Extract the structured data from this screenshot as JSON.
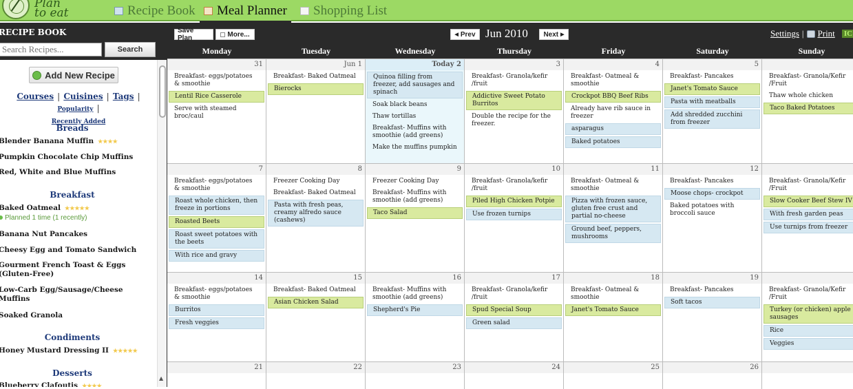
{
  "app": {
    "logo_text_line1": "Plan",
    "logo_text_line2": "to eat",
    "nav_tabs": [
      {
        "label": "Recipe Book",
        "icon": "book-icon",
        "active": false
      },
      {
        "label": "Meal Planner",
        "icon": "calendar-icon",
        "active": true
      },
      {
        "label": "Shopping List",
        "icon": "document-icon",
        "active": false
      }
    ]
  },
  "sidebar": {
    "title": "RECIPE BOOK",
    "search_placeholder": "Search Recipes...",
    "search_button": "Search",
    "add_button": "Add New Recipe",
    "filters": {
      "courses": "Courses",
      "cuisines": "Cuisines",
      "tags": "Tags",
      "popularity": "Popularity",
      "recently_added": "Recently Added",
      "separator": "|"
    },
    "categories": [
      {
        "name": "Breads",
        "recipes": [
          {
            "name": "Blender Banana Muffin",
            "rating": 4
          },
          {
            "name": "Pumpkin Chocolate Chip Muffins",
            "rating": 0
          },
          {
            "name": "Red, White and Blue Muffins",
            "rating": 0
          }
        ]
      },
      {
        "name": "Breakfast",
        "recipes": [
          {
            "name": "Baked Oatmeal",
            "rating": 5,
            "planned": "Planned 1 time (1 recently)"
          },
          {
            "name": "Banana Nut Pancakes",
            "rating": 0
          },
          {
            "name": "Cheesy Egg and Tomato Sandwich",
            "rating": 0
          },
          {
            "name": "Gourment French Toast & Eggs (Gluten-Free)",
            "rating": 0
          },
          {
            "name": "Low-Carb Egg/Sausage/Cheese Muffins",
            "rating": 0
          },
          {
            "name": "Soaked Granola",
            "rating": 0
          }
        ]
      },
      {
        "name": "Condiments",
        "recipes": [
          {
            "name": "Honey Mustard Dressing II",
            "rating": 5
          }
        ]
      },
      {
        "name": "Desserts",
        "recipes": [
          {
            "name": "Blueberry Clafoutis",
            "rating": 4
          }
        ]
      }
    ],
    "stars_4": "★★★★",
    "stars_5": "★★★★★",
    "scroll_up": "▲"
  },
  "toolbar": {
    "save_plan": "Save Plan",
    "more": "More...",
    "prev": "Prev",
    "next": "Next",
    "prev_arrow": "◀",
    "next_arrow": "▶",
    "month": "Jun 2010",
    "settings": "Settings",
    "separator": "|",
    "print": "Print",
    "ic_badge": "IC"
  },
  "calendar": {
    "weekdays": [
      "Monday",
      "Tuesday",
      "Wednesday",
      "Thursday",
      "Friday",
      "Saturday",
      "Sunday"
    ],
    "weeks": [
      [
        {
          "label": "31",
          "items": [
            {
              "text": "Breakfast- eggs/potatoes & smoothie",
              "type": "plain"
            },
            {
              "text": "Lentil Rice Casserole",
              "type": "recipe"
            },
            {
              "text": "Serve with steamed broc/caul",
              "type": "plain"
            }
          ]
        },
        {
          "label": "Jun 1",
          "items": [
            {
              "text": "Breakfast- Baked Oatmeal",
              "type": "plain"
            },
            {
              "text": "Bierocks",
              "type": "recipe"
            }
          ]
        },
        {
          "label": "Today 2",
          "today": true,
          "items": [
            {
              "text": "Quinoa filling from freezer, add sausages and spinach",
              "type": "note"
            },
            {
              "text": "Soak black beans",
              "type": "plain"
            },
            {
              "text": "Thaw tortillas",
              "type": "plain"
            },
            {
              "text": "Breakfast- Muffins with smoothie (add greens)",
              "type": "plain"
            },
            {
              "text": "Make the muffins pumpkin",
              "type": "plain"
            }
          ]
        },
        {
          "label": "3",
          "items": [
            {
              "text": "Breakfast- Granola/kefir /fruit",
              "type": "plain"
            },
            {
              "text": "Addictive Sweet Potato Burritos",
              "type": "recipe"
            },
            {
              "text": "Double the recipe for the freezer.",
              "type": "plain"
            }
          ]
        },
        {
          "label": "4",
          "items": [
            {
              "text": "Breakfast- Oatmeal & smoothie",
              "type": "plain"
            },
            {
              "text": "Crockpot BBQ Beef Ribs",
              "type": "recipe"
            },
            {
              "text": "Already have rib sauce in freezer",
              "type": "plain"
            },
            {
              "text": "asparagus",
              "type": "note"
            },
            {
              "text": "Baked potatoes",
              "type": "note"
            }
          ]
        },
        {
          "label": "5",
          "items": [
            {
              "text": "Breakfast- Pancakes",
              "type": "plain"
            },
            {
              "text": "Janet's Tomato Sauce",
              "type": "recipe"
            },
            {
              "text": "Pasta with meatballs",
              "type": "note"
            },
            {
              "text": "Add shredded zucchini from freezer",
              "type": "note"
            }
          ]
        },
        {
          "label": "",
          "items": [
            {
              "text": "Breakfast- Granola/Kefir /Fruit",
              "type": "plain"
            },
            {
              "text": "Thaw whole chicken",
              "type": "plain"
            },
            {
              "text": "Taco Baked Potatoes",
              "type": "recipe"
            }
          ]
        }
      ],
      [
        {
          "label": "7",
          "items": [
            {
              "text": "Breakfast- eggs/potatoes & smoothie",
              "type": "plain"
            },
            {
              "text": "Roast whole chicken, then freeze in portions",
              "type": "note"
            },
            {
              "text": "Roasted Beets",
              "type": "recipe"
            },
            {
              "text": "Roast sweet potatoes with the beets",
              "type": "note"
            },
            {
              "text": "With rice and gravy",
              "type": "note"
            }
          ]
        },
        {
          "label": "8",
          "items": [
            {
              "text": "Freezer Cooking Day",
              "type": "plain"
            },
            {
              "text": "Breakfast- Baked Oatmeal",
              "type": "plain"
            },
            {
              "text": "Pasta with fresh peas, creamy alfredo sauce (cashews)",
              "type": "note"
            }
          ]
        },
        {
          "label": "9",
          "items": [
            {
              "text": "Freezer Cooking Day",
              "type": "plain"
            },
            {
              "text": "Breakfast- Muffins with smoothie (add greens)",
              "type": "plain"
            },
            {
              "text": "Taco Salad",
              "type": "recipe"
            }
          ]
        },
        {
          "label": "10",
          "items": [
            {
              "text": "Breakfast- Granola/kefir /fruit",
              "type": "plain"
            },
            {
              "text": "Piled High Chicken Potpie",
              "type": "recipe"
            },
            {
              "text": "Use frozen turnips",
              "type": "note"
            }
          ]
        },
        {
          "label": "11",
          "items": [
            {
              "text": "Breakfast- Oatmeal & smoothie",
              "type": "plain"
            },
            {
              "text": "Pizza with frozen sauce, gluten free crust and partial no-cheese",
              "type": "note"
            },
            {
              "text": "Ground beef, peppers, mushrooms",
              "type": "note"
            }
          ]
        },
        {
          "label": "12",
          "items": [
            {
              "text": "Breakfast- Pancakes",
              "type": "plain"
            },
            {
              "text": "Moose chops- crockpot",
              "type": "note"
            },
            {
              "text": "Baked potatoes with broccoli sauce",
              "type": "plain"
            }
          ]
        },
        {
          "label": "",
          "items": [
            {
              "text": "Breakfast- Granola/Kefir /Fruit",
              "type": "plain"
            },
            {
              "text": "Slow Cooker Beef Stew IV",
              "type": "recipe"
            },
            {
              "text": "With fresh garden peas",
              "type": "note"
            },
            {
              "text": "Use turnips from freezer",
              "type": "note"
            }
          ]
        }
      ],
      [
        {
          "label": "14",
          "items": [
            {
              "text": "Breakfast- eggs/potatoes & smoothie",
              "type": "plain"
            },
            {
              "text": "Burritos",
              "type": "note"
            },
            {
              "text": "Fresh veggies",
              "type": "note"
            }
          ]
        },
        {
          "label": "15",
          "items": [
            {
              "text": "Breakfast- Baked Oatmeal",
              "type": "plain"
            },
            {
              "text": "Asian Chicken Salad",
              "type": "recipe"
            }
          ]
        },
        {
          "label": "16",
          "items": [
            {
              "text": "Breakfast- Muffins with smoothie (add greens)",
              "type": "plain"
            },
            {
              "text": "Shepherd's Pie",
              "type": "note"
            }
          ]
        },
        {
          "label": "17",
          "items": [
            {
              "text": "Breakfast- Granola/kefir /fruit",
              "type": "plain"
            },
            {
              "text": "Spud Special Soup",
              "type": "recipe"
            },
            {
              "text": "Green salad",
              "type": "note"
            }
          ]
        },
        {
          "label": "18",
          "items": [
            {
              "text": "Breakfast- Oatmeal & smoothie",
              "type": "plain"
            },
            {
              "text": "Janet's Tomato Sauce",
              "type": "recipe"
            }
          ]
        },
        {
          "label": "19",
          "items": [
            {
              "text": "Breakfast- Pancakes",
              "type": "plain"
            },
            {
              "text": "Soft tacos",
              "type": "note"
            }
          ]
        },
        {
          "label": "",
          "items": [
            {
              "text": "Breakfast- Granola/Kefir /Fruit",
              "type": "plain"
            },
            {
              "text": "Turkey (or chicken) apple sausages",
              "type": "recipe"
            },
            {
              "text": "Rice",
              "type": "note"
            },
            {
              "text": "Veggies",
              "type": "note"
            }
          ]
        }
      ],
      [
        {
          "label": "21",
          "items": []
        },
        {
          "label": "22",
          "items": []
        },
        {
          "label": "23",
          "items": []
        },
        {
          "label": "24",
          "items": []
        },
        {
          "label": "25",
          "items": []
        },
        {
          "label": "26",
          "items": []
        },
        {
          "label": "",
          "items": []
        }
      ]
    ]
  }
}
